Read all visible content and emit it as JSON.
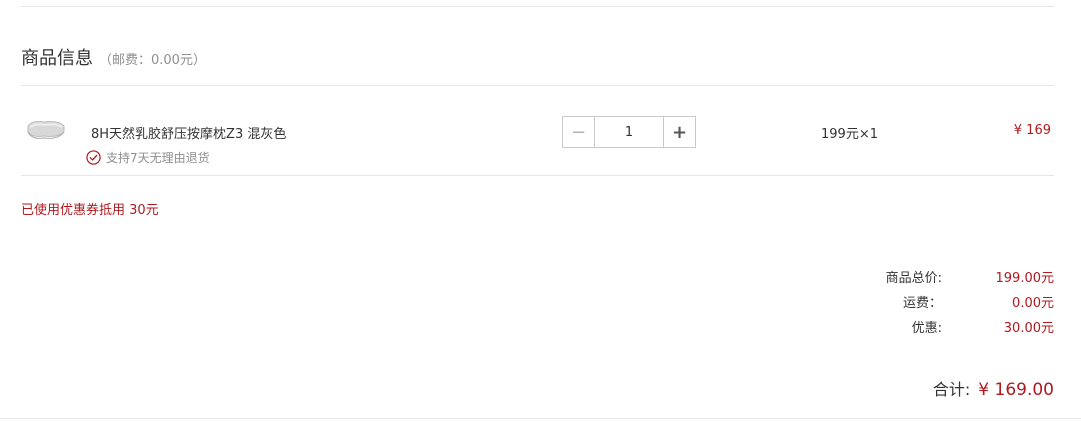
{
  "section": {
    "title": "商品信息",
    "postage": "（邮费：0.00元）"
  },
  "product": {
    "name": "8H天然乳胶舒压按摩枕Z3 混灰色",
    "return_policy": "支持7天无理由退货",
    "quantity": "1",
    "unit_price": "199元×1",
    "subtotal": "¥ 169",
    "minus_symbol": "−",
    "plus_symbol": "+",
    "thumbnail_icon": "pillow-thumbnail"
  },
  "coupon": {
    "note": "已使用优惠券抵用 30元"
  },
  "summary": {
    "items_total_label": "商品总价:",
    "items_total_value": "199.00元",
    "shipping_label": "运费：",
    "shipping_value": "0.00元",
    "discount_label": "优惠:",
    "discount_value": "30.00元"
  },
  "total": {
    "label": "合计:",
    "value": "¥ 169.00"
  },
  "colors": {
    "accent": "#b0191e",
    "text": "#333333",
    "muted": "#8f8f8f",
    "divider": "#e6e6e6"
  }
}
